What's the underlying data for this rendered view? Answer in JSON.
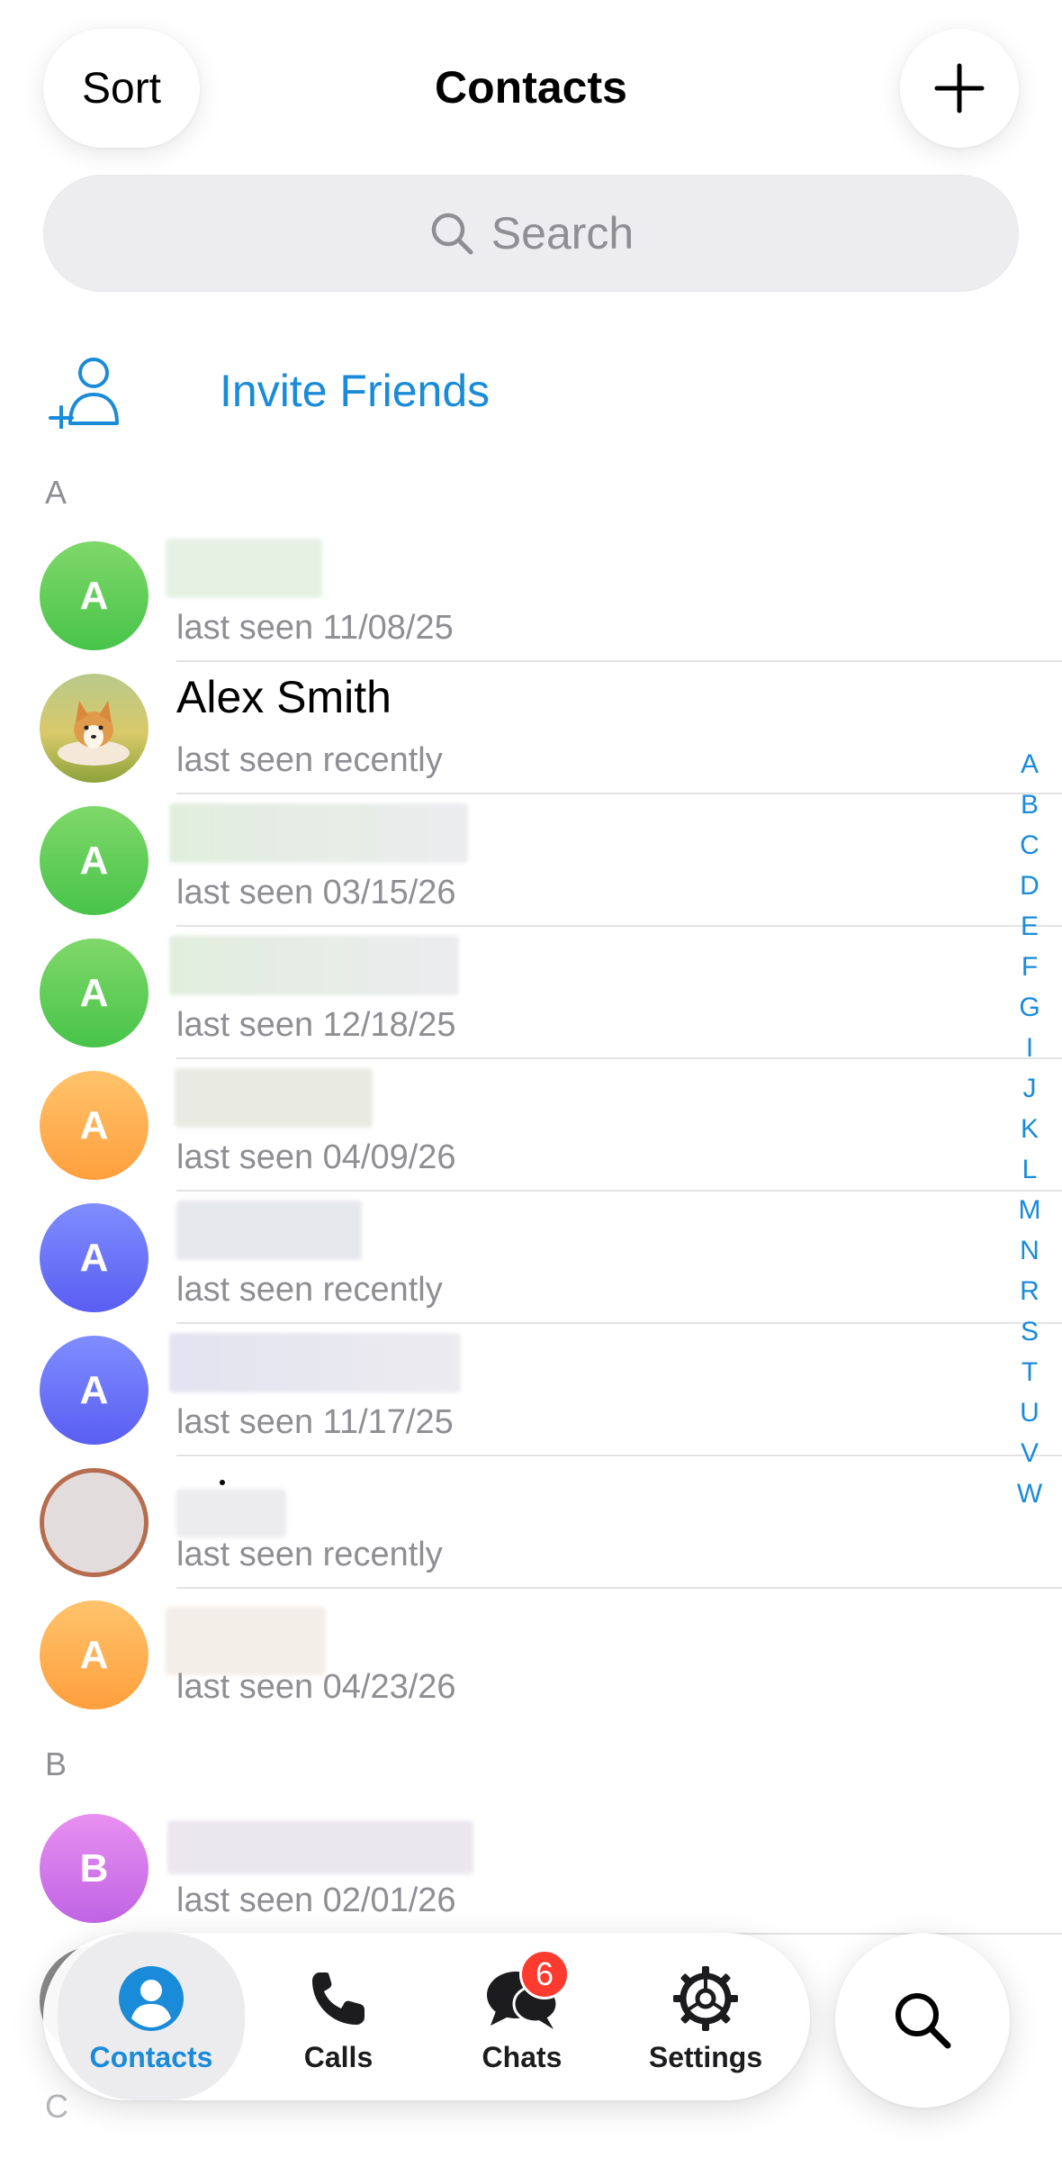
{
  "header": {
    "sort_label": "Sort",
    "title": "Contacts",
    "add_icon": "plus-icon"
  },
  "search": {
    "placeholder": "Search"
  },
  "invite": {
    "label": "Invite Friends",
    "icon": "add-person-icon"
  },
  "sections": [
    {
      "letter": "A"
    },
    {
      "letter": "B"
    },
    {
      "letter": "C"
    }
  ],
  "contacts": [
    {
      "initial": "A",
      "name": "",
      "status": "last seen 11/08/25",
      "color": "#5ccd53"
    },
    {
      "initial": "",
      "name": "Alex Smith",
      "status": "last seen recently",
      "photo": "corgi-photo"
    },
    {
      "initial": "A",
      "name": "",
      "status": "last seen 03/15/26",
      "color": "#5ccd53"
    },
    {
      "initial": "A",
      "name": "",
      "status": "last seen 12/18/25",
      "color": "#5ccd53"
    },
    {
      "initial": "A",
      "name": "",
      "status": "last seen 04/09/26",
      "color": "#ffad4f"
    },
    {
      "initial": "A",
      "name": "",
      "status": "last seen recently",
      "color": "#6a6ef7"
    },
    {
      "initial": "A",
      "name": "",
      "status": "last seen 11/17/25",
      "color": "#6a6ef7"
    },
    {
      "initial": "",
      "name": "",
      "status": "last seen recently",
      "photo": "blurred-photo"
    },
    {
      "initial": "A",
      "name": "",
      "status": "last seen 04/23/26",
      "color": "#ffad4f"
    },
    {
      "initial": "B",
      "name": "",
      "status": "last seen 02/01/26",
      "color": "#d27ae8"
    }
  ],
  "alphabet_index": [
    "A",
    "B",
    "C",
    "D",
    "E",
    "F",
    "G",
    "I",
    "J",
    "K",
    "L",
    "M",
    "N",
    "R",
    "S",
    "T",
    "U",
    "V",
    "W"
  ],
  "tabbar": {
    "tabs": [
      {
        "label": "Contacts",
        "icon": "person-circle-icon",
        "active": true
      },
      {
        "label": "Calls",
        "icon": "phone-icon"
      },
      {
        "label": "Chats",
        "icon": "chat-bubbles-icon",
        "badge": "6"
      },
      {
        "label": "Settings",
        "icon": "gear-icon"
      }
    ],
    "search_icon": "search-icon"
  },
  "colors": {
    "accent": "#1a8bd8",
    "badge": "#ff3b30",
    "secondary_text": "#8e8e93"
  }
}
